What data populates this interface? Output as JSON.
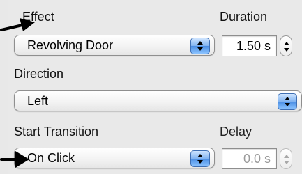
{
  "effect": {
    "label": "Effect",
    "value": "Revolving Door"
  },
  "duration": {
    "label": "Duration",
    "value": "1.50 s"
  },
  "direction": {
    "label": "Direction",
    "value": "Left"
  },
  "start_transition": {
    "label": "Start Transition",
    "value": "On Click"
  },
  "delay": {
    "label": "Delay",
    "value": "0.0 s",
    "disabled": true
  },
  "colors": {
    "popup_button_blue": "#4a8de3",
    "annotation_arrow": "#000000",
    "disabled_text": "#9a9a9a"
  },
  "icons": {
    "popup_arrows": "up-down-chevron-icon",
    "stepper": "stepper-arrows-icon",
    "annotation": "annotation-arrow-icon"
  }
}
